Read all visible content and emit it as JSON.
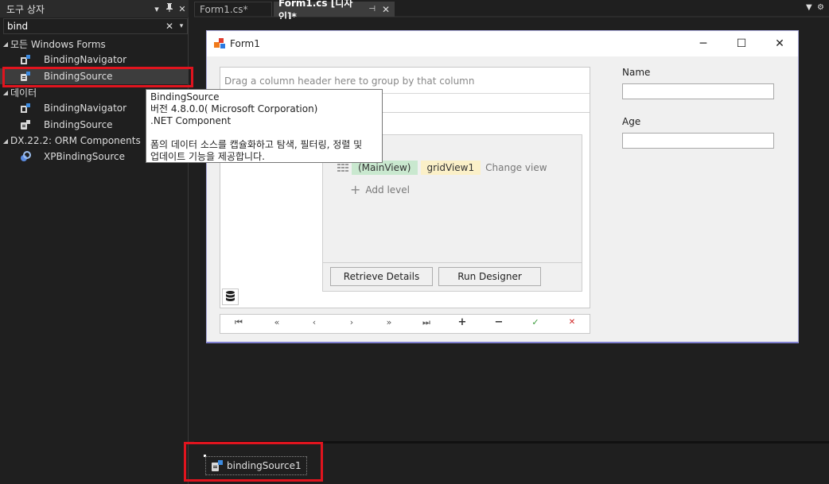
{
  "toolbox": {
    "title": "도구 상자",
    "controls": {
      "dropdown": "▾",
      "pin": "⊿",
      "close": "✕"
    },
    "search_value": "bind",
    "groups": [
      {
        "label": "모든 Windows Forms",
        "items": [
          "BindingNavigator",
          "BindingSource"
        ]
      },
      {
        "label": "데이터",
        "items": [
          "BindingNavigator",
          "BindingSource"
        ]
      },
      {
        "label": "DX.22.2: ORM Components",
        "items": [
          "XPBindingSource"
        ]
      }
    ],
    "selected_item": "BindingSource"
  },
  "tabs": [
    {
      "label": "Form1.cs*",
      "active": false
    },
    {
      "label": "Form1.cs [디자인]*",
      "active": true
    }
  ],
  "form": {
    "caption": "Form1",
    "window_buttons": {
      "minimize": "─",
      "maximize": "☐",
      "close": "✕"
    },
    "grid": {
      "group_panel_text": "Drag a column header here to group by that column",
      "main_view": "(MainView)",
      "grid_view": "gridView1",
      "change_view": "Change view",
      "add_level": "Add level",
      "retrieve_details": "Retrieve Details",
      "run_designer": "Run Designer"
    },
    "fields": [
      {
        "label": "Name",
        "value": ""
      },
      {
        "label": "Age",
        "value": ""
      }
    ],
    "navigator_glyphs": [
      "⏮",
      "«",
      "‹",
      "›",
      "»",
      "⏭",
      "+",
      "−",
      "✓",
      "✕"
    ]
  },
  "tooltip": {
    "line1": "BindingSource",
    "line2": "버전 4.8.0.0( Microsoft Corporation)",
    "line3": ".NET Component",
    "line4": "폼의 데이터 소스를 캡슐화하고 탐색, 필터링, 정렬 및",
    "line5": "업데이트 기능을 제공합니다."
  },
  "tray": {
    "component": "bindingSource1"
  },
  "colors": {
    "highlight": "#e0141e",
    "main_view_bg": "#c9e8cf",
    "grid_view_bg": "#fbf0c8",
    "ok": "#3a9a3a",
    "cancel": "#d02020"
  }
}
